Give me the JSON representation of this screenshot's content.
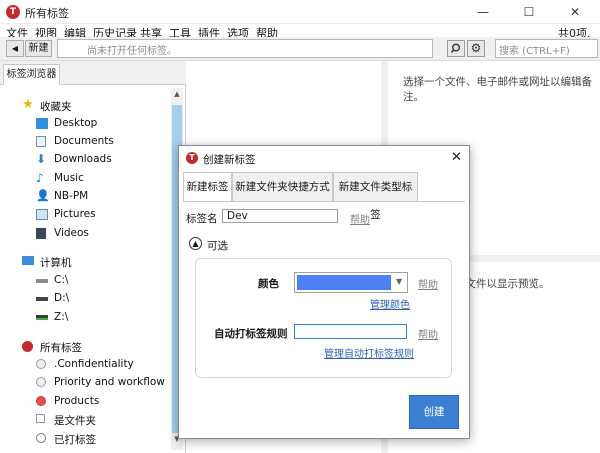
{
  "window": {
    "title": "所有标签",
    "min": "—",
    "max": "☐",
    "close": "✕"
  },
  "menu": [
    "文件",
    "视图",
    "编辑",
    "历史记录",
    "共享",
    "工具",
    "插件",
    "选项",
    "帮助"
  ],
  "item_count": "共0项.",
  "toolbar": {
    "back": "◀",
    "new_label": "新建",
    "path_placeholder": "尚未打开任何标签。",
    "search_placeholder": "搜索 (CTRL+F)"
  },
  "left_panel": {
    "tab": "标签浏览器",
    "favorites": {
      "label": "收藏夹",
      "items": [
        "Desktop",
        "Documents",
        "Downloads",
        "Music",
        "NB-PM",
        "Pictures",
        "Videos"
      ]
    },
    "computer": {
      "label": "计算机",
      "items": [
        "C:\\",
        "D:\\",
        "Z:\\"
      ]
    },
    "all_tags": {
      "label": "所有标签",
      "items": [
        ".Confidentiality",
        "Priority and workflow",
        "Products",
        "是文件夹",
        "已打标签"
      ]
    }
  },
  "note_hint": "选择一个文件、电子邮件或网址以编辑备注。",
  "preview_hint": "件文件以显示预览。",
  "dialog": {
    "title": "创建新标签",
    "close": "✕",
    "tabs": [
      "新建标签",
      "新建文件夹快捷方式",
      "新建文件类型标签"
    ],
    "name_label": "标签名",
    "name_value": "Dev",
    "help": "帮助",
    "optional": "可选",
    "color_label": "颜色",
    "color_value": "#4f80f4",
    "manage_colors": "管理颜色",
    "rules_label": "自动打标签规则",
    "manage_rules": "管理自动打标签规则",
    "create": "创建"
  },
  "colors": {
    "accent": "#3c7fd2",
    "scroll_thumb": "#a6d0ee",
    "logo": "#c22b2b"
  }
}
